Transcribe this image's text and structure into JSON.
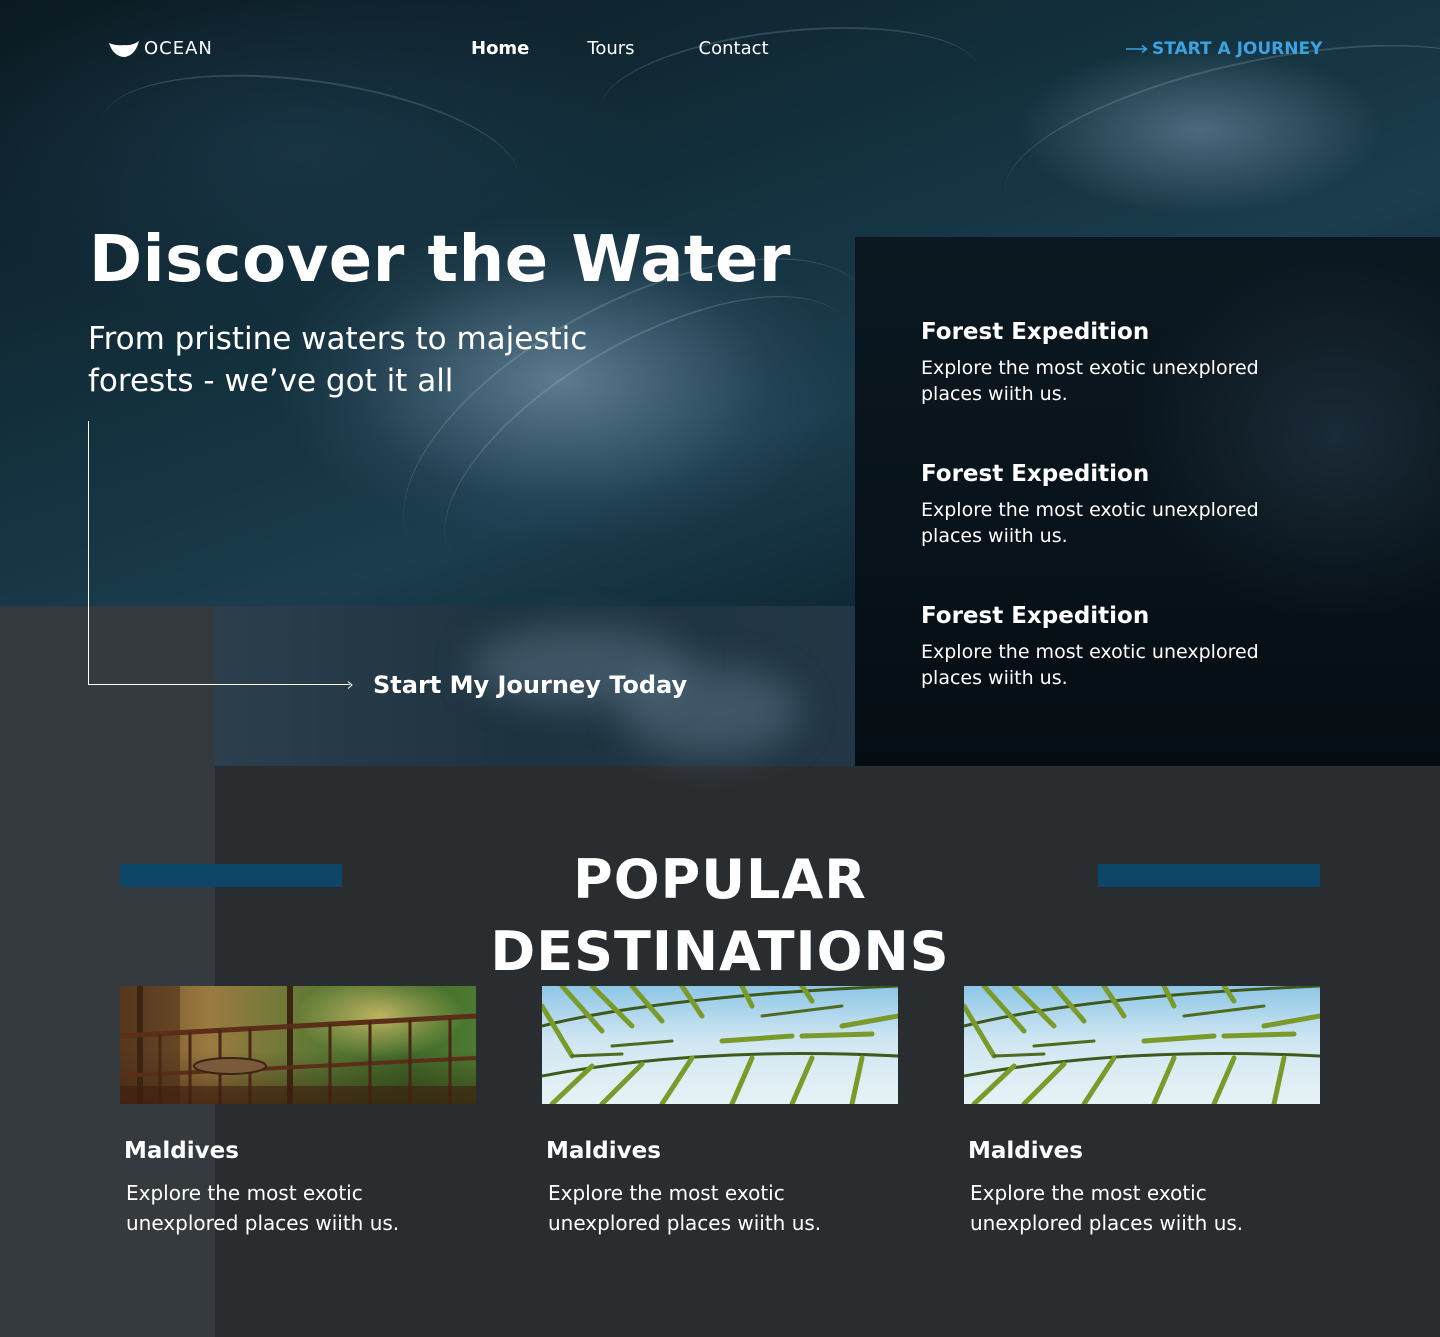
{
  "brand": {
    "name": "OCEAN",
    "logo_icon": "whale-tail-icon"
  },
  "nav": {
    "items": [
      {
        "label": "Home",
        "active": true
      },
      {
        "label": "Tours",
        "active": false
      },
      {
        "label": "Contact",
        "active": false
      }
    ],
    "cta_label": "START A JOURNEY",
    "cta_icon": "arrow-right-icon"
  },
  "hero": {
    "title": "Discover the Water",
    "subtitle": "From pristine waters to majestic forests - we’ve got it all",
    "link_label": "Start My Journey Today"
  },
  "features": [
    {
      "title": "Forest Expedition",
      "text": "Explore the most exotic unexplored places wiith us."
    },
    {
      "title": "Forest Expedition",
      "text": "Explore the most exotic unexplored places wiith us."
    },
    {
      "title": "Forest Expedition",
      "text": "Explore the most exotic unexplored places wiith us."
    }
  ],
  "popular": {
    "title": "POPULAR DESTINATIONS",
    "cards": [
      {
        "title": "Maldives",
        "text": "Explore the most exotic unexplored places wiith us.",
        "image": "terrace-forest-photo"
      },
      {
        "title": "Maldives",
        "text": "Explore the most exotic unexplored places wiith us.",
        "image": "palm-leaves-photo"
      },
      {
        "title": "Maldives",
        "text": "Explore the most exotic unexplored places wiith us.",
        "image": "palm-leaves-photo"
      }
    ]
  },
  "colors": {
    "accent": "#3aa3e0",
    "section_bar": "#0c4566",
    "background": "#2a2d30",
    "panel": "#08131b"
  }
}
